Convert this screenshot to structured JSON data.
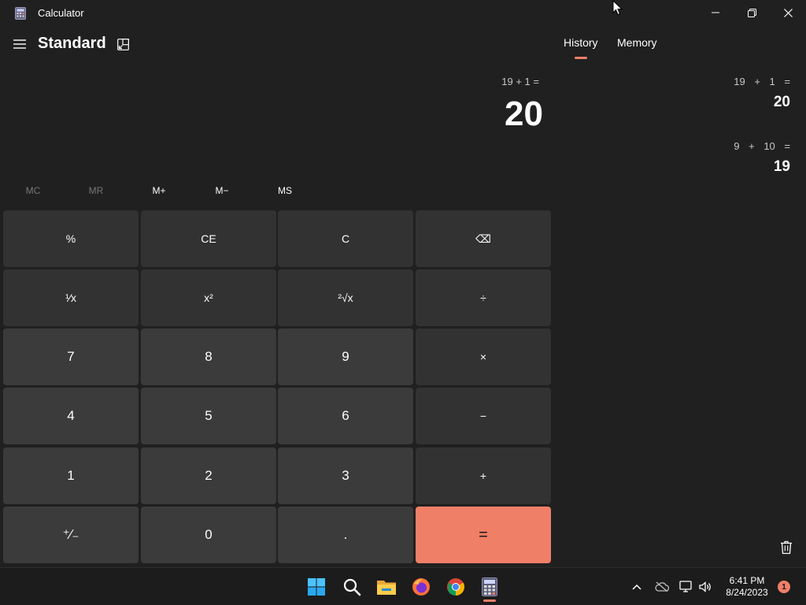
{
  "window": {
    "title": "Calculator"
  },
  "header": {
    "mode": "Standard"
  },
  "display": {
    "expression": "19 + 1 =",
    "value": "20"
  },
  "memory_buttons": [
    {
      "label": "MC",
      "enabled": false
    },
    {
      "label": "MR",
      "enabled": false
    },
    {
      "label": "M+",
      "enabled": true
    },
    {
      "label": "M−",
      "enabled": true
    },
    {
      "label": "MS",
      "enabled": true
    }
  ],
  "keypad": [
    [
      {
        "label": "%",
        "name": "percent-button",
        "style": "op"
      },
      {
        "label": "CE",
        "name": "clear-entry-button",
        "style": "op"
      },
      {
        "label": "C",
        "name": "clear-button",
        "style": "op"
      },
      {
        "label": "⌫",
        "name": "backspace-button",
        "style": "op"
      }
    ],
    [
      {
        "label": "¹⁄x",
        "name": "reciprocal-button",
        "style": "op"
      },
      {
        "label": "x²",
        "name": "square-button",
        "style": "op"
      },
      {
        "label": "²√x",
        "name": "square-root-button",
        "style": "op"
      },
      {
        "label": "÷",
        "name": "divide-button",
        "style": "op"
      }
    ],
    [
      {
        "label": "7",
        "name": "digit-7-button",
        "style": "num"
      },
      {
        "label": "8",
        "name": "digit-8-button",
        "style": "num"
      },
      {
        "label": "9",
        "name": "digit-9-button",
        "style": "num"
      },
      {
        "label": "×",
        "name": "multiply-button",
        "style": "op"
      }
    ],
    [
      {
        "label": "4",
        "name": "digit-4-button",
        "style": "num"
      },
      {
        "label": "5",
        "name": "digit-5-button",
        "style": "num"
      },
      {
        "label": "6",
        "name": "digit-6-button",
        "style": "num"
      },
      {
        "label": "−",
        "name": "subtract-button",
        "style": "op"
      }
    ],
    [
      {
        "label": "1",
        "name": "digit-1-button",
        "style": "num"
      },
      {
        "label": "2",
        "name": "digit-2-button",
        "style": "num"
      },
      {
        "label": "3",
        "name": "digit-3-button",
        "style": "num"
      },
      {
        "label": "+",
        "name": "add-button",
        "style": "op"
      }
    ],
    [
      {
        "label": "⁺∕₋",
        "name": "negate-button",
        "style": "num"
      },
      {
        "label": "0",
        "name": "digit-0-button",
        "style": "num"
      },
      {
        "label": ".",
        "name": "decimal-button",
        "style": "num"
      },
      {
        "label": "=",
        "name": "equals-button",
        "style": "equals"
      }
    ]
  ],
  "panel": {
    "tabs": [
      {
        "label": "History",
        "active": true
      },
      {
        "label": "Memory",
        "active": false
      }
    ],
    "history": [
      {
        "expression": "19 + 1 =",
        "result": "20"
      },
      {
        "expression": "9 + 10 =",
        "result": "19"
      }
    ]
  },
  "taskbar": {
    "apps": [
      {
        "name": "start-icon"
      },
      {
        "name": "search-icon"
      },
      {
        "name": "file-explorer-icon"
      },
      {
        "name": "firefox-icon"
      },
      {
        "name": "chrome-icon"
      },
      {
        "name": "calculator-icon"
      }
    ],
    "clock": {
      "time": "6:41 PM",
      "date": "8/24/2023"
    },
    "notification_count": "1"
  },
  "colors": {
    "background": "#202020",
    "accent": "#f07f67",
    "key_number": "#3b3b3b",
    "key_operator": "#323232"
  }
}
